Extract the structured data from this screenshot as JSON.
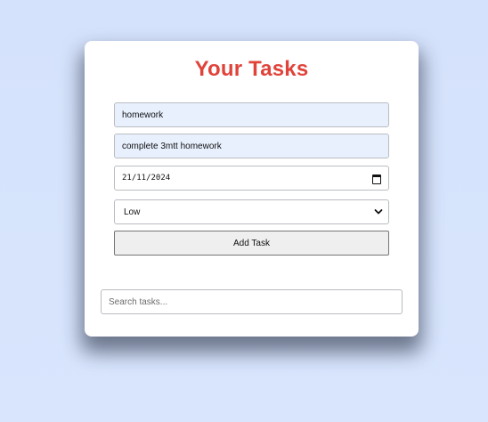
{
  "header": {
    "title": "Your Tasks"
  },
  "form": {
    "task_name": "homework",
    "task_description": "complete 3mtt homework",
    "due_date": "21/11/2024",
    "priority": "Low",
    "add_button_label": "Add Task"
  },
  "search": {
    "placeholder": "Search tasks..."
  },
  "icons": {
    "date_picker": "calendar-icon",
    "priority_select": "chevron-down-icon"
  },
  "colors": {
    "title": "#e0433a",
    "autofill_bg": "#e8f0fe",
    "page_bg": "#d5e2fb"
  }
}
